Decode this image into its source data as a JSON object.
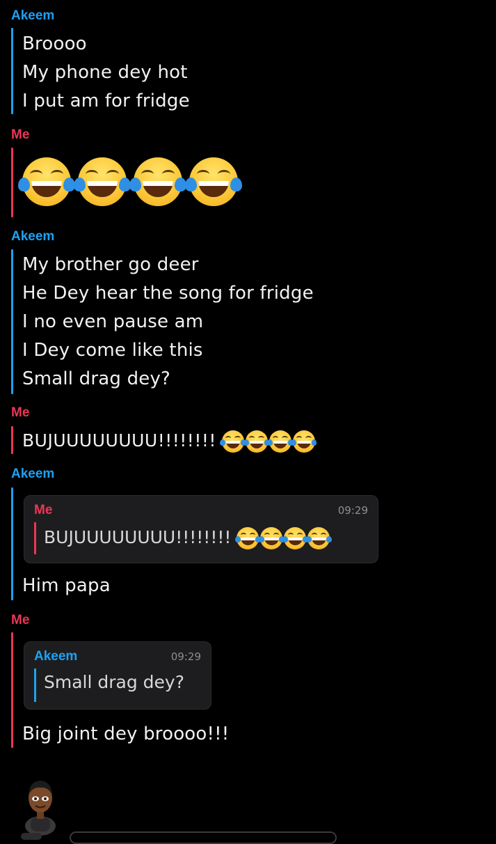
{
  "messages": [
    {
      "sender": "Akeem",
      "lines": [
        "Broooo",
        "My phone dey hot",
        "I put am for fridge"
      ]
    },
    {
      "sender": "Me",
      "emoji": "face-with-tears-of-joy",
      "emoji_count": 4
    },
    {
      "sender": "Akeem",
      "lines": [
        "My brother go deer",
        "He Dey hear the song for fridge",
        "I no even pause am",
        "I Dey come like this",
        "Small drag dey?"
      ]
    },
    {
      "sender": "Me",
      "text": "BUJUUUUUUUU!!!!!!!!"
    },
    {
      "sender": "Akeem",
      "reply_to": {
        "sender": "Me",
        "time": "09:29",
        "text": "BUJUUUUUUUU!!!!!!!!"
      },
      "text": "Him papa"
    },
    {
      "sender": "Me",
      "reply_to": {
        "sender": "Akeem",
        "time": "09:29",
        "text": "Small drag dey?"
      },
      "text": "Big joint dey broooo!!!"
    }
  ],
  "colors": {
    "akeem": "#1ea1f2",
    "me": "#ee3555",
    "background": "#000000",
    "quote_background": "#1d1d1f"
  },
  "icons": {
    "laugh_emoji": "face-with-tears-of-joy-icon",
    "avatar": "bitmoji-avatar-icon"
  }
}
